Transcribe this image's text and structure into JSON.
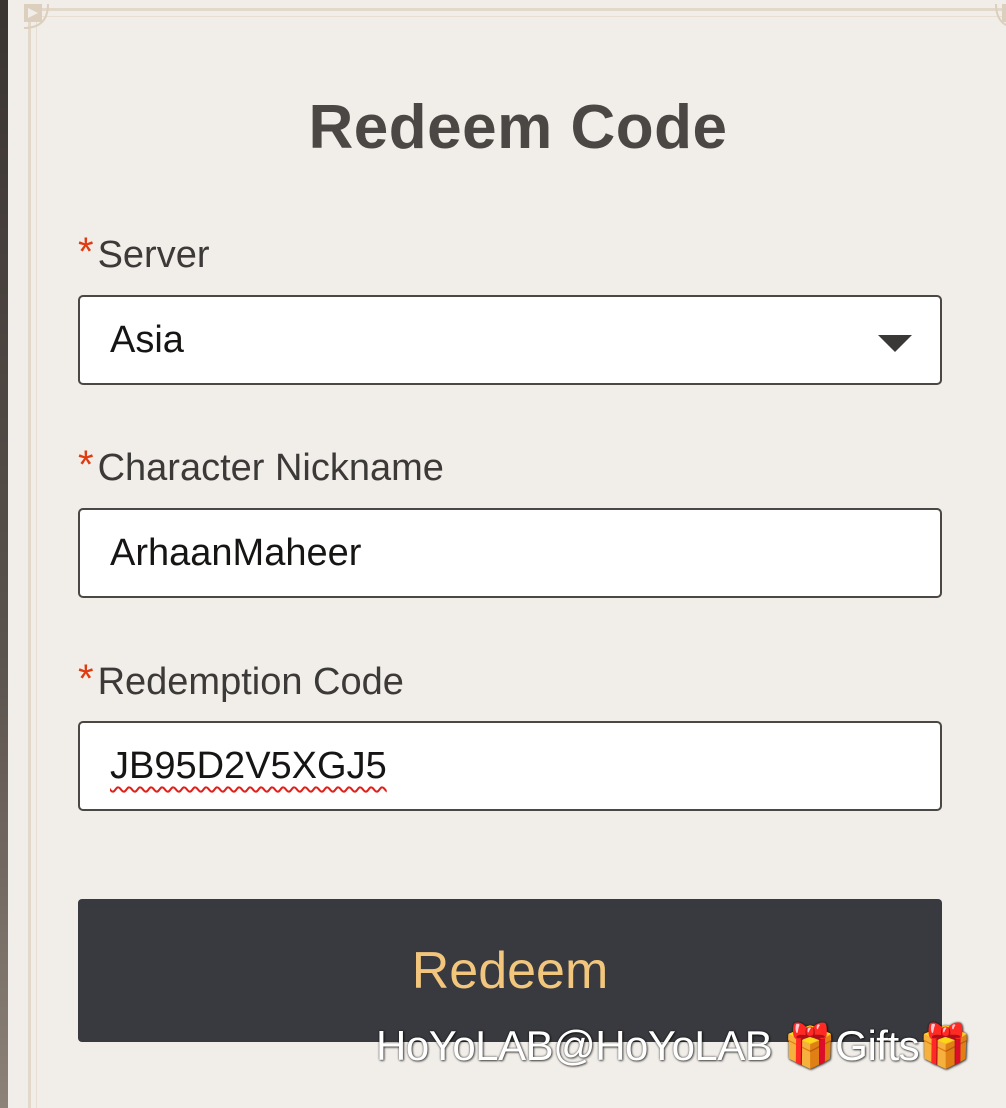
{
  "dialog": {
    "title": "Redeem Code"
  },
  "form": {
    "server": {
      "required_mark": "*",
      "label": "Server",
      "value": "Asia"
    },
    "nickname": {
      "required_mark": "*",
      "label": "Character Nickname",
      "value": "ArhaanMaheer"
    },
    "code": {
      "required_mark": "*",
      "label": "Redemption Code",
      "value": "JB95D2V5XGJ5"
    },
    "submit_label": "Redeem"
  },
  "watermark": {
    "text": "HoYoLAB@HoYoLAB 🎁Gifts🎁"
  },
  "colors": {
    "panel_bg": "#f1ede8",
    "button_bg": "#393a3f",
    "button_text": "#f2c67c",
    "required_mark": "#e03a10"
  }
}
